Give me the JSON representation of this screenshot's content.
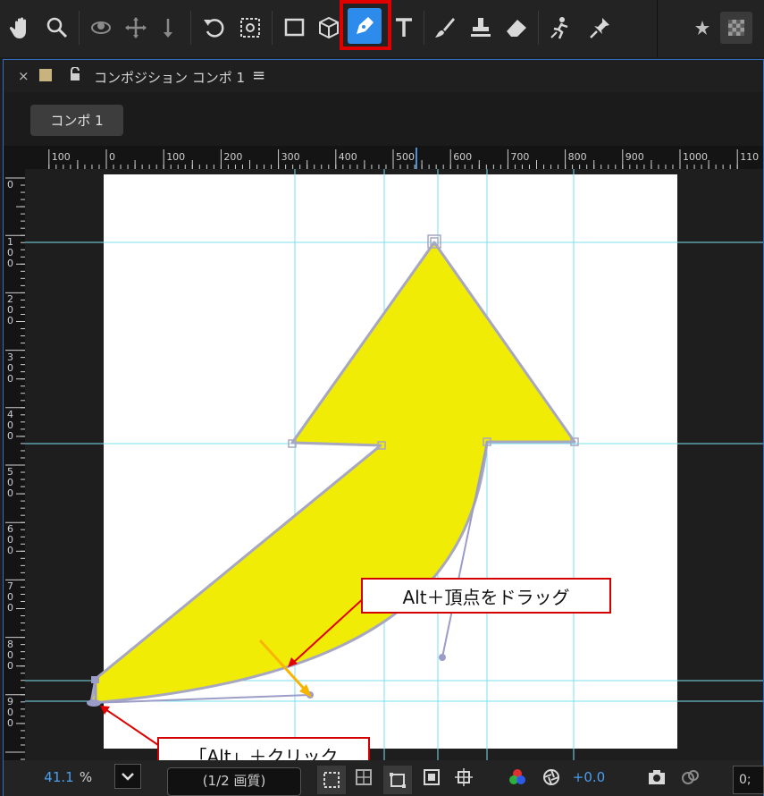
{
  "toolbar": {
    "tools": [
      {
        "name": "hand-tool",
        "icon": "hand-icon"
      },
      {
        "name": "zoom-tool",
        "icon": "magnifier-icon"
      },
      {
        "name": "orbit-camera-tool",
        "icon": "orbit-icon"
      },
      {
        "name": "pan-camera-tool",
        "icon": "move-icon"
      },
      {
        "name": "dolly-camera-tool",
        "icon": "dolly-icon"
      },
      {
        "name": "rotation-tool",
        "icon": "rotate-icon"
      },
      {
        "name": "pan-behind-tool",
        "icon": "anchor-point-icon"
      },
      {
        "name": "rectangle-tool",
        "icon": "rectangle-icon"
      },
      {
        "name": "extrude-tool",
        "icon": "cube-icon"
      },
      {
        "name": "pen-tool",
        "icon": "pen-icon"
      },
      {
        "name": "type-tool",
        "icon": "type-icon"
      },
      {
        "name": "brush-tool",
        "icon": "brush-icon"
      },
      {
        "name": "clone-stamp-tool",
        "icon": "stamp-icon"
      },
      {
        "name": "eraser-tool",
        "icon": "eraser-icon"
      },
      {
        "name": "roto-brush-tool",
        "icon": "roto-brush-icon"
      },
      {
        "name": "puppet-pin-tool",
        "icon": "pin-icon"
      }
    ],
    "colors": {
      "pen_active": "#2d8ceb",
      "highlight": "#e00000"
    }
  },
  "panel": {
    "title": "コンポジション コンポ 1",
    "close_glyph": "×",
    "menu_glyph": "≡",
    "tab": "コンポ 1"
  },
  "ruler": {
    "h_labels": [
      "100",
      "0",
      "100",
      "200",
      "300",
      "400",
      "500",
      "600",
      "700",
      "800",
      "900",
      "1000",
      "110"
    ],
    "v_labels": [
      {
        "t": "0"
      },
      {
        "t": "1\n0\n0"
      },
      {
        "t": "2\n0\n0"
      },
      {
        "t": "3\n0\n0"
      },
      {
        "t": "4\n0\n0"
      },
      {
        "t": "5\n0\n0"
      },
      {
        "t": "6\n0\n0"
      },
      {
        "t": "7\n0\n0"
      },
      {
        "t": "8\n0\n0"
      },
      {
        "t": "9\n0\n0"
      }
    ]
  },
  "shape": {
    "fill": "#f1ec06",
    "stroke": "#a7a7c2",
    "guide": "#7be0ee",
    "handle": "#9c9cc8",
    "drag_arrow": "#f7b400"
  },
  "callouts": {
    "drag": "Alt＋頂点をドラッグ",
    "click": "「Alt」＋クリック"
  },
  "bottom": {
    "zoom": "41.1",
    "zoom_unit": "%",
    "resolution": "(1/2 画質)",
    "exposure": "+0.0",
    "timecode": "0;"
  }
}
